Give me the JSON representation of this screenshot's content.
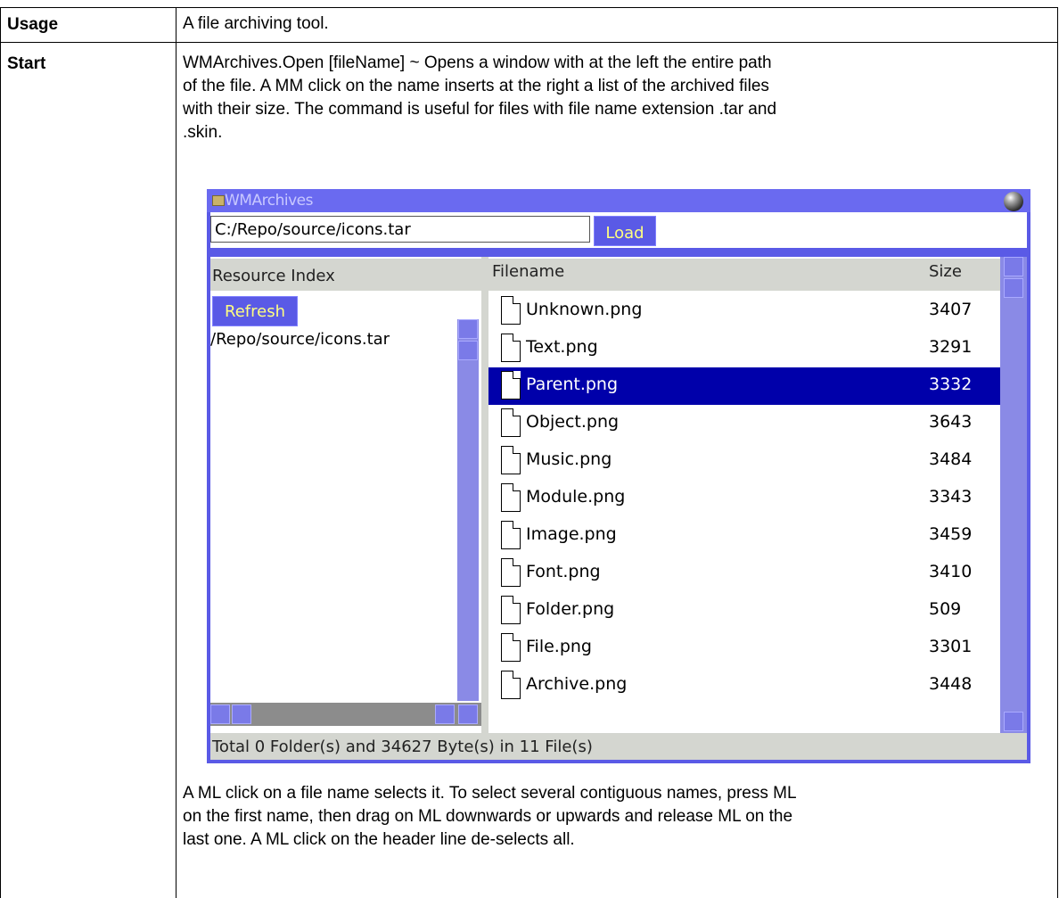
{
  "rows": [
    {
      "label": "Usage",
      "text": "A file archiving tool."
    },
    {
      "label": "Start",
      "text_lines": [
        "WMArchives.Open [fileName] ~    Opens a window with at the left the entire path",
        "of the file. A MM click on the name inserts at the right a list of the archived files",
        "with their size. The command is useful for files with file name extension .tar and",
        ".skin."
      ],
      "after_lines": [
        "A ML click on a file name selects it. To select several contiguous names, press ML",
        "on the first name, then drag on ML downwards or upwards and release ML on the",
        "last one. A ML click on the header line de-selects all."
      ]
    }
  ],
  "window": {
    "title": "WMArchives",
    "path": "C:/Repo/source/icons.tar",
    "load_label": "Load",
    "resource_header": "Resource Index",
    "refresh_label": "Refresh",
    "resource_item": "/Repo/source/icons.tar",
    "col_filename": "Filename",
    "col_size": "Size",
    "files": [
      {
        "name": "Unknown.png",
        "size": "3407"
      },
      {
        "name": "Text.png",
        "size": "3291"
      },
      {
        "name": "Parent.png",
        "size": "3332"
      },
      {
        "name": "Object.png",
        "size": "3643"
      },
      {
        "name": "Music.png",
        "size": "3484"
      },
      {
        "name": "Module.png",
        "size": "3343"
      },
      {
        "name": "Image.png",
        "size": "3459"
      },
      {
        "name": "Font.png",
        "size": "3410"
      },
      {
        "name": "Folder.png",
        "size": "509"
      },
      {
        "name": "File.png",
        "size": "3301"
      },
      {
        "name": "Archive.png",
        "size": "3448"
      }
    ],
    "selected_file": "Parent.png",
    "status": "Total 0 Folder(s) and 34627 Byte(s) in 11 File(s)",
    "colors": {
      "window_bg": "#5a5ae6",
      "selection": "#0000aa",
      "button_text": "#ffff80",
      "scrollbar": "#8a8ae6"
    }
  }
}
